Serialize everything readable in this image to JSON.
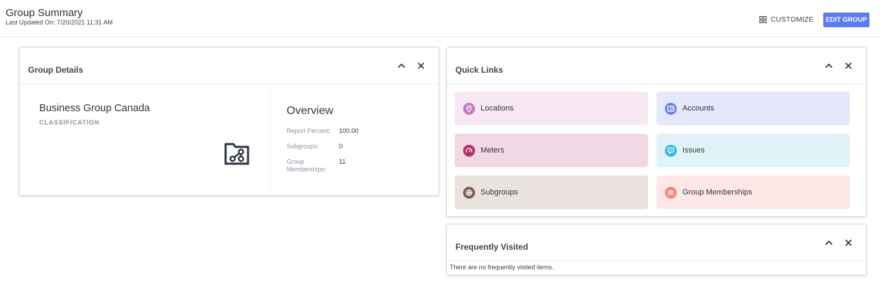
{
  "header": {
    "title": "Group Summary",
    "last_updated": "Last Updated On: 7/20/2021 11:31 AM",
    "customize_label": "CUSTOMIZE",
    "edit_label": "EDIT GROUP"
  },
  "group_details": {
    "title": "Group Details",
    "name": "Business Group Canada",
    "classification": "CLASSIFICATION",
    "overview_title": "Overview",
    "rows": [
      {
        "label": "Report Percent:",
        "value": "100.00"
      },
      {
        "label": "Subgroups:",
        "value": "0"
      },
      {
        "label": "Group Memberships:",
        "value": "11"
      }
    ]
  },
  "quick_links": {
    "title": "Quick Links",
    "items": [
      {
        "label": "Locations",
        "icon": "location-pin-icon",
        "bg": "#f8e8f4",
        "icon_bg": "#c978c0"
      },
      {
        "label": "Accounts",
        "icon": "account-card-icon",
        "bg": "#e4e8fa",
        "icon_bg": "#6c7fe4"
      },
      {
        "label": "Meters",
        "icon": "gauge-icon",
        "bg": "#f0d9e5",
        "icon_bg": "#b03464"
      },
      {
        "label": "Issues",
        "icon": "issue-chat-icon",
        "bg": "#e0f3f9",
        "icon_bg": "#33b9dc"
      },
      {
        "label": "Subgroups",
        "icon": "subgroup-icon",
        "bg": "#e9e2df",
        "icon_bg": "#7d5f52"
      },
      {
        "label": "Group Memberships",
        "icon": "people-icon",
        "bg": "#fde8e7",
        "icon_bg": "#f28a80"
      }
    ]
  },
  "frequently_visited": {
    "title": "Frequently Visited",
    "empty_text": "There are no frequently visited items."
  }
}
